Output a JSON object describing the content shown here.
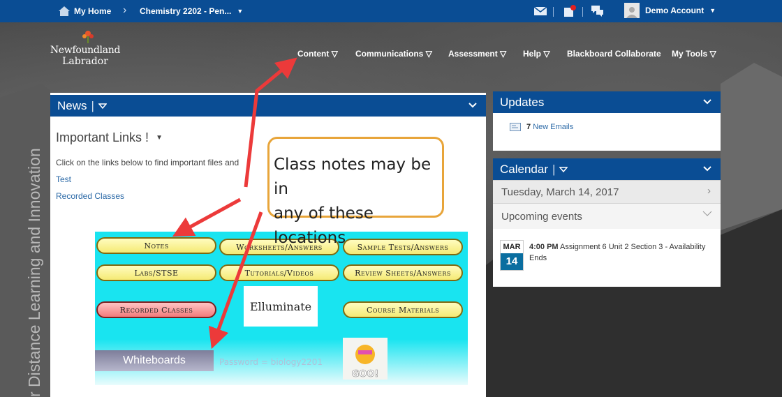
{
  "topbar": {
    "home_label": "My Home",
    "course_label": "Chemistry 2202 - Pen...",
    "account_label": "Demo Account"
  },
  "logo": {
    "line1": "Newfoundland",
    "line2": "Labrador"
  },
  "nav": {
    "items": [
      {
        "label": "Content ▽"
      },
      {
        "label": "Communications ▽"
      },
      {
        "label": "Assessment ▽"
      },
      {
        "label": "Help ▽"
      },
      {
        "label": "Blackboard Collaborate"
      },
      {
        "label": "My Tools ▽"
      }
    ]
  },
  "side_text": "r Distance Learning and Innovation",
  "news": {
    "title": "News",
    "heading": "Important Links !",
    "intro": "Click on the links below to find important files and",
    "links": [
      "Test",
      "Recorded Classes"
    ],
    "banner": {
      "buttons": [
        "Notes",
        "Worksheets/Answers",
        "Sample Tests/Answers",
        "Labs/STSE",
        "Tutorials/Videos",
        "Review Sheets/Answers",
        "Recorded Classes",
        "Course Materials"
      ],
      "illuminate_label": "Elluminate",
      "whiteboards_label": "Whiteboards",
      "password_label": "Password = biology2201",
      "goo_label": "GOO!"
    }
  },
  "callout": {
    "line1": "Class notes may be in",
    "line2": "any of these locations"
  },
  "updates": {
    "title": "Updates",
    "count": "7",
    "label": "New Emails"
  },
  "calendar": {
    "title": "Calendar",
    "date": "Tuesday, March 14, 2017",
    "upcoming": "Upcoming events",
    "event": {
      "month": "MAR",
      "day": "14",
      "time": "4:00 PM",
      "title": "Assignment 6 Unit 2 Section 3 - Availability Ends"
    }
  },
  "colors": {
    "brand_blue": "#0a4d94",
    "banner_cyan": "#19e4f0",
    "arrow_red": "#ec3a3a",
    "callout_border": "#e8a53a"
  }
}
